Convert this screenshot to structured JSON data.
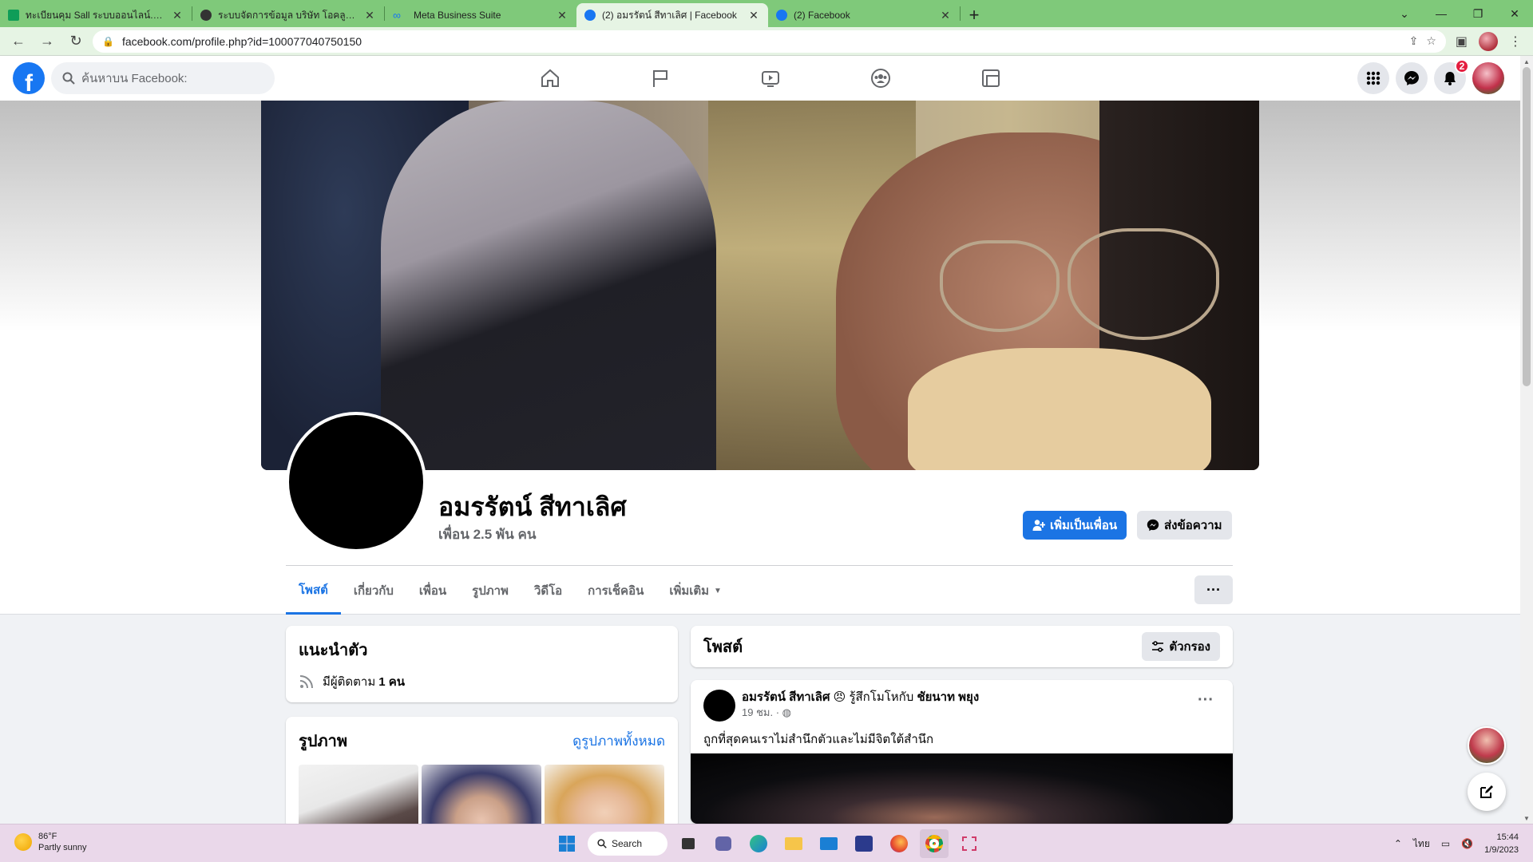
{
  "browser": {
    "tabs": [
      {
        "title": "ทะเบียนคุม Sall ระบบออนไลน์.xlsx - G",
        "favicon_color": "#0f9d58",
        "active": false
      },
      {
        "title": "ระบบจัดการข้อมูล บริษัท โอคลูกเน็ต",
        "favicon_color": "#333333",
        "active": false
      },
      {
        "title": "Meta Business Suite",
        "favicon_color": "#1877f2",
        "active": false
      },
      {
        "title": "(2) อมรรัตน์ สีทาเลิศ | Facebook",
        "favicon_color": "#1877f2",
        "active": true
      },
      {
        "title": "(2) Facebook",
        "favicon_color": "#1877f2",
        "active": false
      }
    ],
    "url": "facebook.com/profile.php?id=100077040750150"
  },
  "fb_header": {
    "search_placeholder": "ค้นหาบน Facebook:",
    "notification_count": "2",
    "nav_icons": [
      "home-icon",
      "pages-flag-icon",
      "watch-video-icon",
      "groups-icon",
      "gaming-icon"
    ]
  },
  "profile": {
    "name": "อมรรัตน์ สีทาเลิศ",
    "friends": "เพื่อน 2.5 พัน คน",
    "add_friend_label": "เพิ่มเป็นเพื่อน",
    "message_label": "ส่งข้อความ",
    "tabs": [
      "โพสต์",
      "เกี่ยวกับ",
      "เพื่อน",
      "รูปภาพ",
      "วิดีโอ",
      "การเช็คอิน",
      "เพิ่มเติม"
    ],
    "more_button": "···"
  },
  "intro": {
    "title": "แนะนำตัว",
    "followers_prefix": "มีผู้ติดตาม",
    "followers_value": "1 คน"
  },
  "photos": {
    "title": "รูปภาพ",
    "see_all": "ดูรูปภาพทั้งหมด"
  },
  "posts_header": {
    "title": "โพสต์",
    "filter_label": "ตัวกรอง"
  },
  "post": {
    "author": "อมรรัตน์ สีทาเลิศ",
    "feeling": "รู้สึกโมโหกับ",
    "tagged": "ชัยนาท พยุง",
    "time": "19 ชม. ·",
    "text": "ถูกที่สุดคนเราไม่สำนึกตัวและไม่มีจิตใต้สำนึก"
  },
  "taskbar": {
    "temperature": "86°F",
    "weather": "Partly sunny",
    "search_label": "Search",
    "language": "ไทย",
    "time": "15:44",
    "date": "1/9/2023"
  }
}
